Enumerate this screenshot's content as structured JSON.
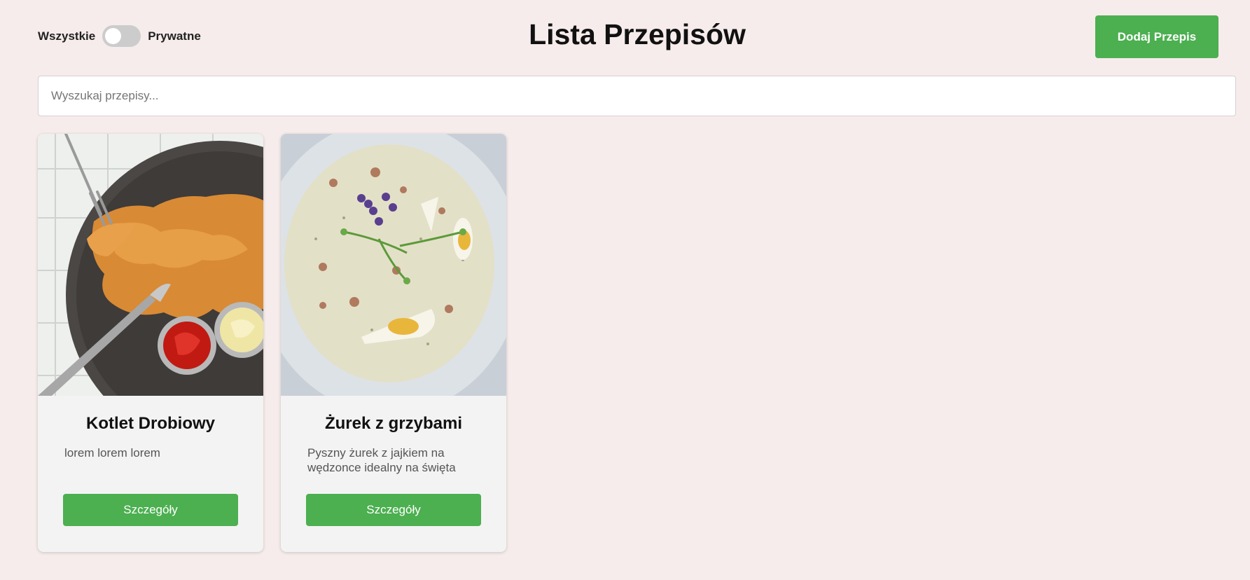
{
  "header": {
    "toggle_left_label": "Wszystkie",
    "toggle_right_label": "Prywatne",
    "toggle_state": "off",
    "title": "Lista Przepisów",
    "add_button_label": "Dodaj Przepis"
  },
  "search": {
    "placeholder": "Wyszukaj przepisy...",
    "value": ""
  },
  "recipes": [
    {
      "title": "Kotlet Drobiowy",
      "description": "lorem lorem lorem",
      "button_label": "Szczegóły",
      "image": "fried-chicken-cutlet-photo"
    },
    {
      "title": "Żurek z grzybami",
      "description": "Pyszny żurek z jajkiem na wędzonce idealny na święta",
      "button_label": "Szczegóły",
      "image": "zurek-soup-photo"
    }
  ],
  "colors": {
    "background": "#f6eceb",
    "accent": "#4caf50",
    "card": "#f3f3f3"
  }
}
